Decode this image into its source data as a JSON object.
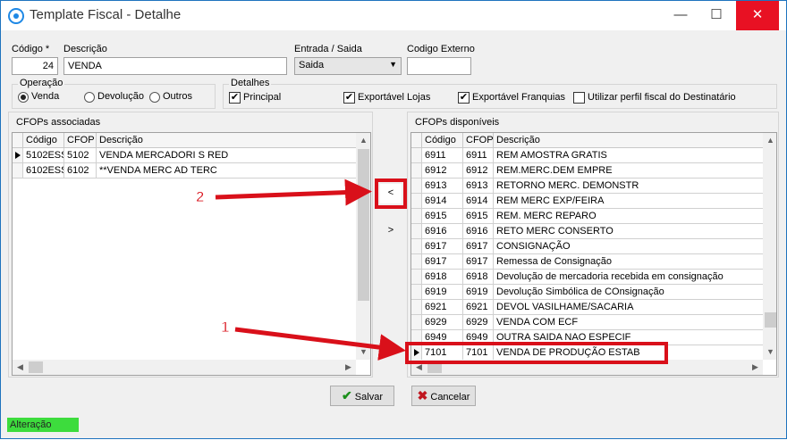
{
  "window": {
    "title": "Template Fiscal - Detalhe",
    "minimize": "—",
    "maximize": "☐",
    "close": "✕"
  },
  "form": {
    "codigo_label": "Código *",
    "codigo_value": "24",
    "descricao_label": "Descrição",
    "descricao_value": "VENDA",
    "entrada_label": "Entrada / Saida",
    "entrada_value": "Saida",
    "codigo_externo_label": "Codigo Externo",
    "codigo_externo_value": ""
  },
  "operacao": {
    "title": "Operação",
    "options": [
      "Venda",
      "Devolução",
      "Outros"
    ],
    "selected": "Venda"
  },
  "detalhes": {
    "title": "Detalhes",
    "checks": [
      {
        "label": "Principal",
        "checked": true
      },
      {
        "label": "Exportável Lojas",
        "checked": true
      },
      {
        "label": "Exportável Franquias",
        "checked": true
      },
      {
        "label": "Utilizar perfil fiscal do Destinatário",
        "checked": false
      }
    ]
  },
  "associadas": {
    "title": "CFOPs associadas",
    "columns": [
      "Código",
      "CFOP",
      "Descrição"
    ],
    "rows": [
      [
        "5102ESS",
        "5102",
        "VENDA MERCADORI S RED"
      ],
      [
        "6102ESS",
        "6102",
        "**VENDA MERC AD TERC"
      ]
    ]
  },
  "disponiveis": {
    "title": "CFOPs disponíveis",
    "columns": [
      "Código",
      "CFOP",
      "Descrição"
    ],
    "rows": [
      [
        "6911",
        "6911",
        "REM AMOSTRA GRATIS"
      ],
      [
        "6912",
        "6912",
        "REM.MERC.DEM EMPRE"
      ],
      [
        "6913",
        "6913",
        "RETORNO MERC. DEMONSTR"
      ],
      [
        "6914",
        "6914",
        "REM MERC EXP/FEIRA"
      ],
      [
        "6915",
        "6915",
        "REM. MERC REPARO"
      ],
      [
        "6916",
        "6916",
        "RETO MERC CONSERTO"
      ],
      [
        "6917",
        "6917",
        "CONSIGNAÇÃO"
      ],
      [
        "6917",
        "6917",
        "Remessa de Consignação"
      ],
      [
        "6918",
        "6918",
        "Devolução de mercadoria recebida em consignação"
      ],
      [
        "6919",
        "6919",
        "Devolução Simbólica de COnsignação"
      ],
      [
        "6921",
        "6921",
        "DEVOL VASILHAME/SACARIA"
      ],
      [
        "6929",
        "6929",
        "VENDA COM ECF"
      ],
      [
        "6949",
        "6949",
        "OUTRA SAIDA NAO ESPECIF"
      ],
      [
        "7101",
        "7101",
        "VENDA DE PRODUÇÃO ESTAB"
      ]
    ]
  },
  "move": {
    "left": "<",
    "right": ">"
  },
  "buttons": {
    "save": "Salvar",
    "cancel": "Cancelar"
  },
  "status": "Alteração",
  "callouts": {
    "one": "1",
    "two": "2"
  },
  "colors": {
    "highlight": "#d9101a",
    "status": "#3ddc3d"
  }
}
